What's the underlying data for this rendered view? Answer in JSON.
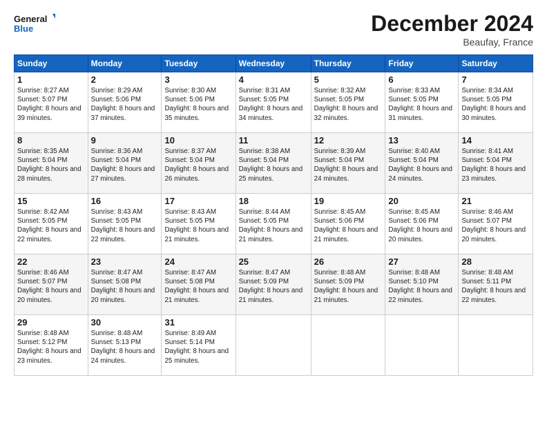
{
  "header": {
    "logo_line1": "General",
    "logo_line2": "Blue",
    "month_title": "December 2024",
    "location": "Beaufay, France"
  },
  "weekdays": [
    "Sunday",
    "Monday",
    "Tuesday",
    "Wednesday",
    "Thursday",
    "Friday",
    "Saturday"
  ],
  "weeks": [
    [
      {
        "day": "1",
        "sunrise": "8:27 AM",
        "sunset": "5:07 PM",
        "daylight": "8 hours and 39 minutes."
      },
      {
        "day": "2",
        "sunrise": "8:29 AM",
        "sunset": "5:06 PM",
        "daylight": "8 hours and 37 minutes."
      },
      {
        "day": "3",
        "sunrise": "8:30 AM",
        "sunset": "5:06 PM",
        "daylight": "8 hours and 35 minutes."
      },
      {
        "day": "4",
        "sunrise": "8:31 AM",
        "sunset": "5:05 PM",
        "daylight": "8 hours and 34 minutes."
      },
      {
        "day": "5",
        "sunrise": "8:32 AM",
        "sunset": "5:05 PM",
        "daylight": "8 hours and 32 minutes."
      },
      {
        "day": "6",
        "sunrise": "8:33 AM",
        "sunset": "5:05 PM",
        "daylight": "8 hours and 31 minutes."
      },
      {
        "day": "7",
        "sunrise": "8:34 AM",
        "sunset": "5:05 PM",
        "daylight": "8 hours and 30 minutes."
      }
    ],
    [
      {
        "day": "8",
        "sunrise": "8:35 AM",
        "sunset": "5:04 PM",
        "daylight": "8 hours and 28 minutes."
      },
      {
        "day": "9",
        "sunrise": "8:36 AM",
        "sunset": "5:04 PM",
        "daylight": "8 hours and 27 minutes."
      },
      {
        "day": "10",
        "sunrise": "8:37 AM",
        "sunset": "5:04 PM",
        "daylight": "8 hours and 26 minutes."
      },
      {
        "day": "11",
        "sunrise": "8:38 AM",
        "sunset": "5:04 PM",
        "daylight": "8 hours and 25 minutes."
      },
      {
        "day": "12",
        "sunrise": "8:39 AM",
        "sunset": "5:04 PM",
        "daylight": "8 hours and 24 minutes."
      },
      {
        "day": "13",
        "sunrise": "8:40 AM",
        "sunset": "5:04 PM",
        "daylight": "8 hours and 24 minutes."
      },
      {
        "day": "14",
        "sunrise": "8:41 AM",
        "sunset": "5:04 PM",
        "daylight": "8 hours and 23 minutes."
      }
    ],
    [
      {
        "day": "15",
        "sunrise": "8:42 AM",
        "sunset": "5:05 PM",
        "daylight": "8 hours and 22 minutes."
      },
      {
        "day": "16",
        "sunrise": "8:43 AM",
        "sunset": "5:05 PM",
        "daylight": "8 hours and 22 minutes."
      },
      {
        "day": "17",
        "sunrise": "8:43 AM",
        "sunset": "5:05 PM",
        "daylight": "8 hours and 21 minutes."
      },
      {
        "day": "18",
        "sunrise": "8:44 AM",
        "sunset": "5:05 PM",
        "daylight": "8 hours and 21 minutes."
      },
      {
        "day": "19",
        "sunrise": "8:45 AM",
        "sunset": "5:06 PM",
        "daylight": "8 hours and 21 minutes."
      },
      {
        "day": "20",
        "sunrise": "8:45 AM",
        "sunset": "5:06 PM",
        "daylight": "8 hours and 20 minutes."
      },
      {
        "day": "21",
        "sunrise": "8:46 AM",
        "sunset": "5:07 PM",
        "daylight": "8 hours and 20 minutes."
      }
    ],
    [
      {
        "day": "22",
        "sunrise": "8:46 AM",
        "sunset": "5:07 PM",
        "daylight": "8 hours and 20 minutes."
      },
      {
        "day": "23",
        "sunrise": "8:47 AM",
        "sunset": "5:08 PM",
        "daylight": "8 hours and 20 minutes."
      },
      {
        "day": "24",
        "sunrise": "8:47 AM",
        "sunset": "5:08 PM",
        "daylight": "8 hours and 21 minutes."
      },
      {
        "day": "25",
        "sunrise": "8:47 AM",
        "sunset": "5:09 PM",
        "daylight": "8 hours and 21 minutes."
      },
      {
        "day": "26",
        "sunrise": "8:48 AM",
        "sunset": "5:09 PM",
        "daylight": "8 hours and 21 minutes."
      },
      {
        "day": "27",
        "sunrise": "8:48 AM",
        "sunset": "5:10 PM",
        "daylight": "8 hours and 22 minutes."
      },
      {
        "day": "28",
        "sunrise": "8:48 AM",
        "sunset": "5:11 PM",
        "daylight": "8 hours and 22 minutes."
      }
    ],
    [
      {
        "day": "29",
        "sunrise": "8:48 AM",
        "sunset": "5:12 PM",
        "daylight": "8 hours and 23 minutes."
      },
      {
        "day": "30",
        "sunrise": "8:48 AM",
        "sunset": "5:13 PM",
        "daylight": "8 hours and 24 minutes."
      },
      {
        "day": "31",
        "sunrise": "8:49 AM",
        "sunset": "5:14 PM",
        "daylight": "8 hours and 25 minutes."
      },
      null,
      null,
      null,
      null
    ]
  ],
  "labels": {
    "sunrise": "Sunrise:",
    "sunset": "Sunset:",
    "daylight": "Daylight:"
  }
}
